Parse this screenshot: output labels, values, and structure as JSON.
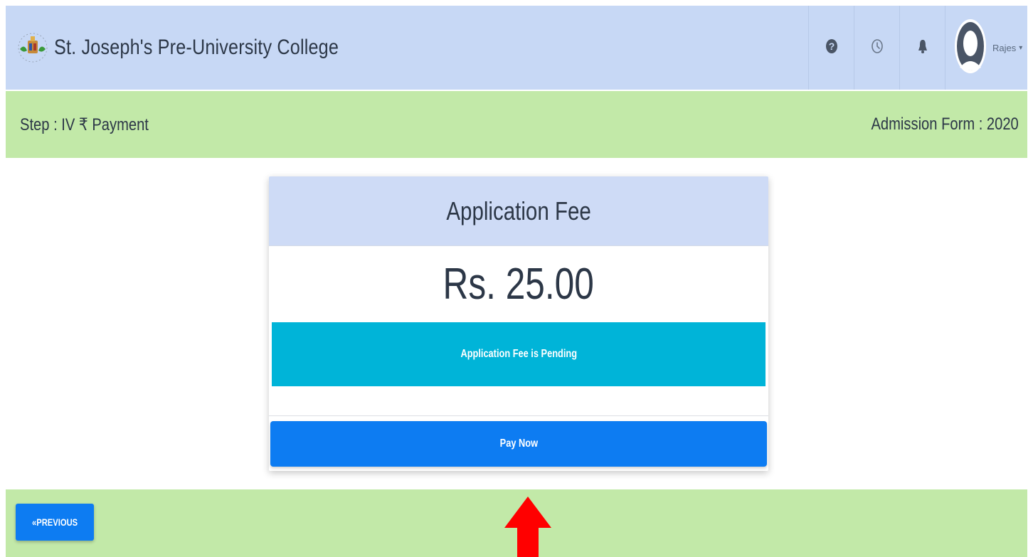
{
  "header": {
    "brand_title": "St. Joseph's Pre-University College",
    "icons": [
      "college-logo",
      "help-icon",
      "history-clock-icon",
      "bell-icon",
      "user-avatar-icon",
      "caret-down-icon"
    ],
    "user_name": "Rajes",
    "caret": "▾"
  },
  "stepbar": {
    "step_label": "Step : IV ₹ Payment",
    "form_label": "Admission Form : 2020"
  },
  "card": {
    "title": "Application Fee",
    "amount": "Rs. 25.00",
    "status_text": "Application Fee is Pending",
    "pay_label": "Pay Now"
  },
  "footer": {
    "previous_label": "«PREVIOUS"
  },
  "colors": {
    "navbar_bg": "#c7d8f5",
    "stepbar_bg": "#c2e9a8",
    "card_header_bg": "#cedbf6",
    "status_bg": "#00b4d8",
    "button_bg": "#0d7cf2",
    "annotation_arrow": "#ff0000"
  }
}
